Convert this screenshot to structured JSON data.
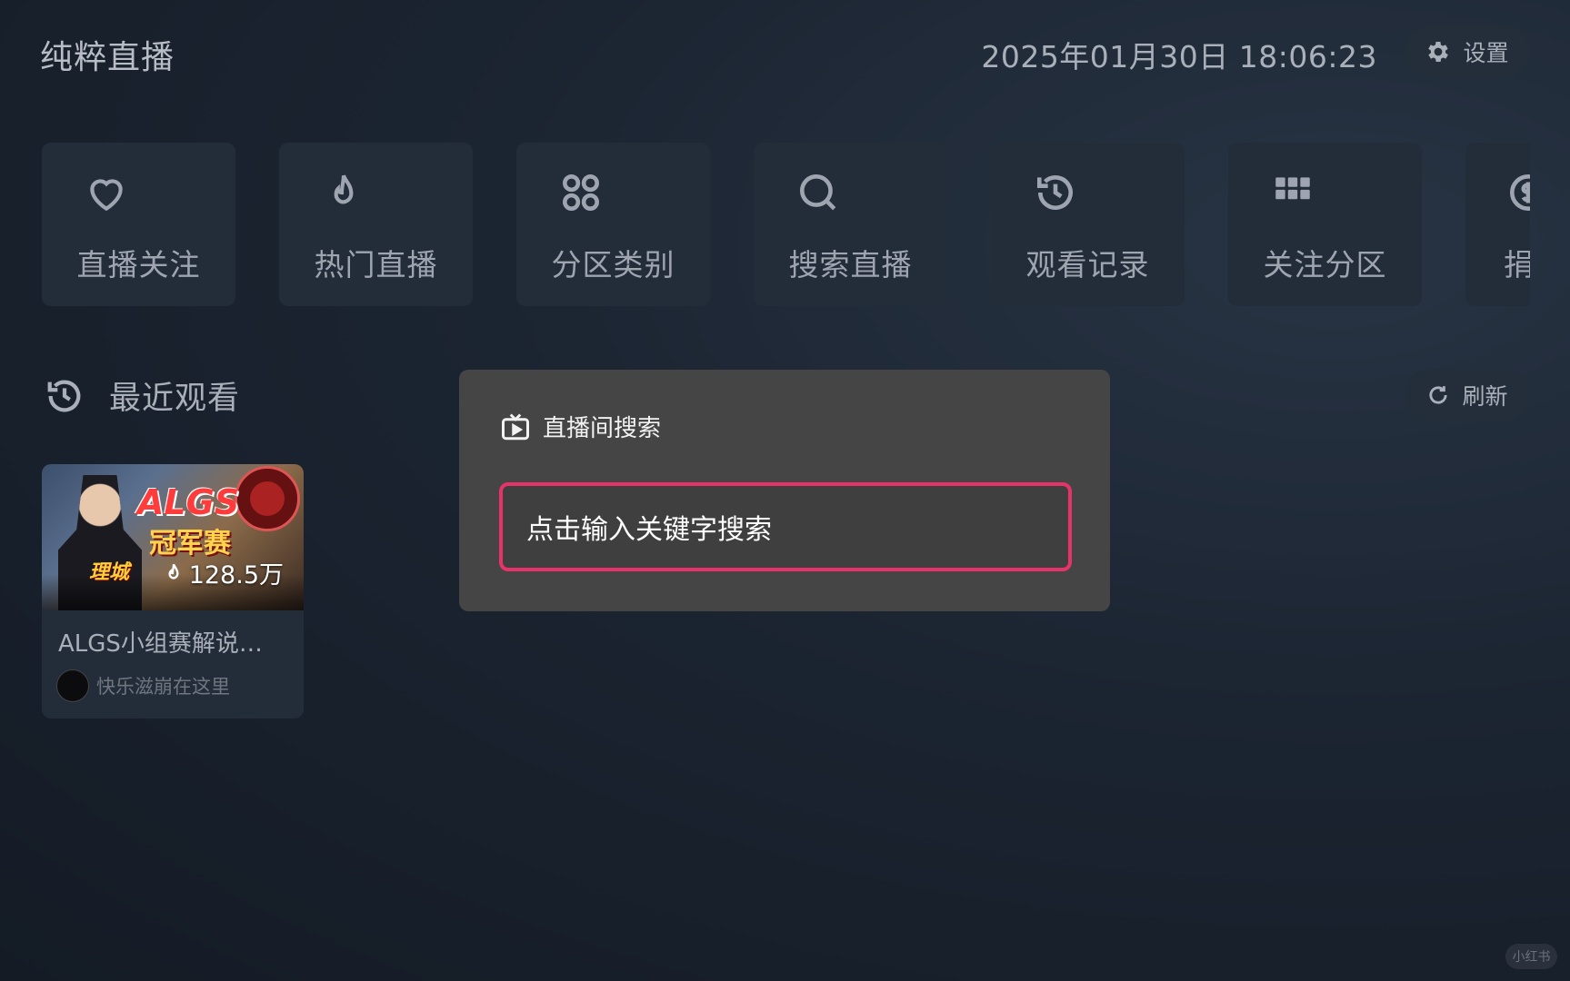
{
  "header": {
    "app_title": "纯粹直播",
    "datetime": "2025年01月30日 18:06:23",
    "settings_label": "设置"
  },
  "nav": {
    "items": [
      {
        "label": "直播关注",
        "icon": "heart-icon"
      },
      {
        "label": "热门直播",
        "icon": "flame-icon"
      },
      {
        "label": "分区类别",
        "icon": "category-icon"
      },
      {
        "label": "搜索直播",
        "icon": "search-icon"
      },
      {
        "label": "观看记录",
        "icon": "history-icon"
      },
      {
        "label": "关注分区",
        "icon": "grid-icon"
      },
      {
        "label": "捐",
        "icon": "donate-icon"
      }
    ]
  },
  "recent": {
    "title": "最近观看",
    "refresh_label": "刷新",
    "rooms": [
      {
        "thumb_title": "ALGS",
        "thumb_subtitle": "冠军赛",
        "thumb_tag": "理城",
        "viewers": "128.5万",
        "title": "ALGS小组赛解说…",
        "streamer": "快乐滋崩在这里"
      }
    ]
  },
  "dialog": {
    "title": "直播间搜索",
    "search_placeholder": "点击输入关键字搜索"
  },
  "watermark": "小红书",
  "colors": {
    "background": "#1b2431",
    "tile": "#232c39",
    "dialog": "#454545",
    "focus_border": "#e8336a"
  }
}
